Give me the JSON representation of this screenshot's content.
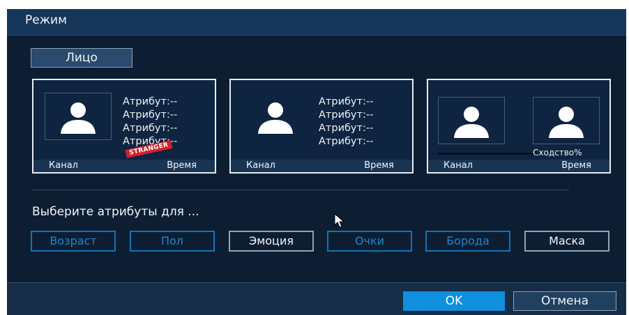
{
  "dialog": {
    "title": "Режим"
  },
  "mode_tab": {
    "label": "Лицо"
  },
  "cards": [
    {
      "attributes": [
        "Атрибут:--",
        "Атрибут:--",
        "Атрибут:--",
        "Атрибут:--"
      ],
      "badge": "STRANGER",
      "channel": "Канал",
      "time": "Время"
    },
    {
      "attributes": [
        "Атрибут:--",
        "Атрибут:--",
        "Атрибут:--",
        "Атрибут:--"
      ],
      "channel": "Канал",
      "time": "Время"
    },
    {
      "similarity": "Сходство%",
      "channel": "Канал",
      "time": "Время"
    }
  ],
  "attribute_section": {
    "prompt": "Выберите атрибуты для ...",
    "options": [
      {
        "label": "Возраст",
        "selected": true
      },
      {
        "label": "Пол",
        "selected": true
      },
      {
        "label": "Эмоция",
        "selected": false
      },
      {
        "label": "Очки",
        "selected": true
      },
      {
        "label": "Борода",
        "selected": true
      },
      {
        "label": "Маска",
        "selected": false
      }
    ]
  },
  "footer": {
    "ok_label": "OK",
    "cancel_label": "Отмена"
  },
  "icons": {
    "face_placeholder": "person-silhouette-icon",
    "cursor": "mouse-pointer-icon"
  },
  "colors": {
    "background": "#0d1e33",
    "accent": "#0f8fdd",
    "selected_border": "#1573b6",
    "badge": "#d3202a"
  }
}
